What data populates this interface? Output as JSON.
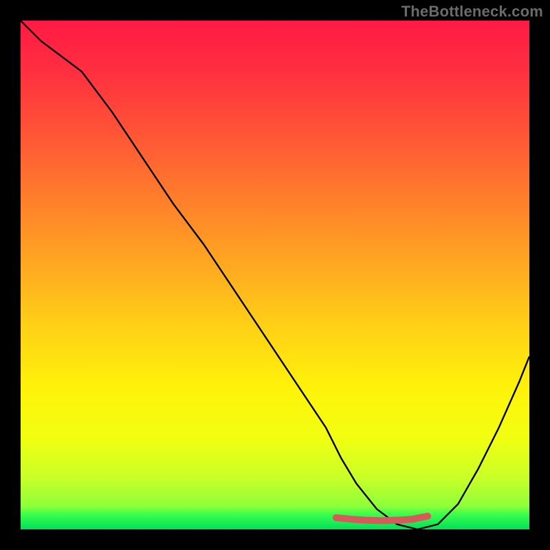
{
  "watermark": "TheBottleneck.com",
  "chart_data": {
    "type": "line",
    "title": "",
    "xlabel": "",
    "ylabel": "",
    "xlim": [
      0,
      100
    ],
    "ylim": [
      0,
      100
    ],
    "grid": false,
    "series": [
      {
        "name": "curve",
        "x": [
          0,
          4,
          8,
          12,
          18,
          24,
          30,
          36,
          42,
          48,
          54,
          60,
          63,
          66,
          70,
          74,
          78,
          82,
          86,
          90,
          94,
          98,
          100
        ],
        "y": [
          100,
          96,
          93,
          90,
          82,
          73,
          64,
          56,
          47,
          38,
          29,
          20,
          14,
          9,
          4,
          1,
          0,
          1,
          5,
          12,
          20,
          29,
          34
        ]
      },
      {
        "name": "highlight",
        "x": [
          62,
          65,
          68,
          71,
          74,
          77,
          80
        ],
        "y": [
          2.3,
          2.0,
          1.8,
          1.7,
          1.8,
          2.0,
          2.6
        ]
      }
    ],
    "gradient_stops": [
      {
        "pct": 0,
        "color": "#ff1a44"
      },
      {
        "pct": 10,
        "color": "#ff2f40"
      },
      {
        "pct": 22,
        "color": "#ff5436"
      },
      {
        "pct": 35,
        "color": "#ff7e2b"
      },
      {
        "pct": 48,
        "color": "#ffa821"
      },
      {
        "pct": 60,
        "color": "#ffd016"
      },
      {
        "pct": 72,
        "color": "#fff20a"
      },
      {
        "pct": 82,
        "color": "#f2ff10"
      },
      {
        "pct": 90,
        "color": "#c8ff28"
      },
      {
        "pct": 95.5,
        "color": "#8cff3a"
      },
      {
        "pct": 97,
        "color": "#3bff4b"
      },
      {
        "pct": 100,
        "color": "#00e05a"
      }
    ],
    "highlight_color": "#d75a5a",
    "curve_color": "#000000"
  }
}
